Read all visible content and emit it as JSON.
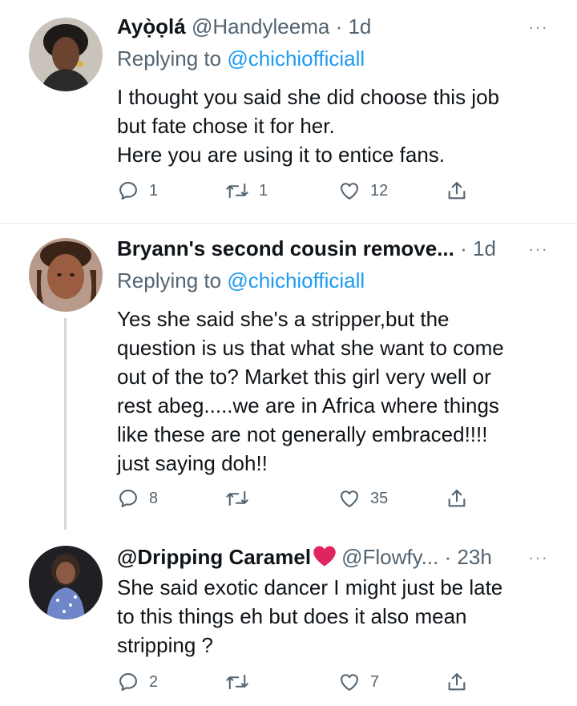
{
  "tweets": [
    {
      "name": "Ayọ̀ọlá",
      "handle": "@Handyleema",
      "time": "1d",
      "reply_prefix": "Replying to ",
      "reply_mention": "@chichiofficiall",
      "lines": [
        "I thought you said she did choose this job",
        "but fate chose it for her.",
        "Here you are using it to entice fans."
      ],
      "reply_count": "1",
      "retweet_count": "1",
      "like_count": "12"
    },
    {
      "name": "Bryann's second cousin remove...",
      "handle": "",
      "time": "1d",
      "reply_prefix": "Replying to ",
      "reply_mention": "@chichiofficiall",
      "lines": [
        "Yes she said she's a stripper,but the",
        "question is us that what she want to come",
        "out of the to? Market this girl very well or",
        "rest abeg.....we are in Africa where things",
        "like these are not generally embraced!!!!",
        "just saying doh!!"
      ],
      "reply_count": "8",
      "retweet_count": "",
      "like_count": "35"
    },
    {
      "name": "@Dripping Caramel",
      "handle": "@Flowfy...",
      "time": "23h",
      "lines": [
        "She said exotic dancer I might just be late",
        "to this things eh but does it also mean",
        "stripping ?"
      ],
      "reply_count": "2",
      "retweet_count": "",
      "like_count": "7"
    }
  ],
  "icons": {
    "more": "more-horizontal-icon",
    "reply": "comment-icon",
    "retweet": "retweet-icon",
    "like": "heart-icon",
    "share": "share-icon",
    "emoji": "red-heart-emoji"
  },
  "colors": {
    "link": "#1d9bf0",
    "secondary": "#536471",
    "text": "#0f1419",
    "emoji_heart": "#e0245e"
  }
}
